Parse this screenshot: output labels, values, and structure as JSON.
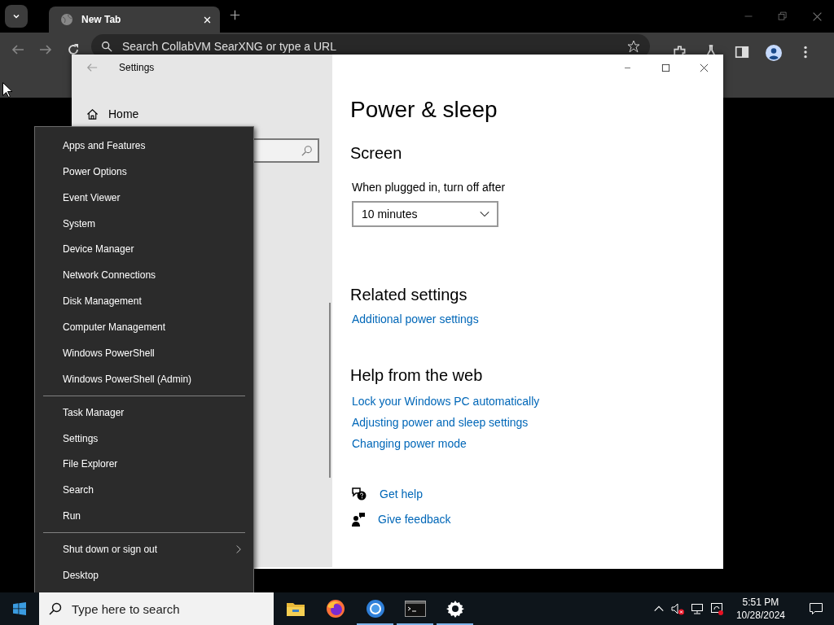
{
  "browser": {
    "tabs": [
      {
        "title": "New Tab",
        "selected": true
      }
    ],
    "address_bar": {
      "placeholder": "Search CollabVM SearXNG or type a URL"
    }
  },
  "settings_window": {
    "title": "Settings",
    "nav": [
      {
        "label": "Home"
      }
    ],
    "page_title": "Power & sleep",
    "screen": {
      "heading": "Screen",
      "label": "When plugged in, turn off after",
      "value": "10 minutes"
    },
    "related_settings": {
      "heading": "Related settings",
      "links": [
        "Additional power settings"
      ]
    },
    "help_from_web": {
      "heading": "Help from the web",
      "links": [
        "Lock your Windows PC automatically",
        "Adjusting power and sleep settings",
        "Changing power mode"
      ]
    },
    "support_links": [
      {
        "label": "Get help",
        "kind": "help"
      },
      {
        "label": "Give feedback",
        "kind": "feedback"
      }
    ]
  },
  "context_menu": {
    "groups": [
      [
        {
          "label": "Apps and Features",
          "submenu": false
        },
        {
          "label": "Power Options",
          "submenu": false
        },
        {
          "label": "Event Viewer",
          "submenu": false
        },
        {
          "label": "System",
          "submenu": false
        },
        {
          "label": "Device Manager",
          "submenu": false
        },
        {
          "label": "Network Connections",
          "submenu": false
        },
        {
          "label": "Disk Management",
          "submenu": false
        },
        {
          "label": "Computer Management",
          "submenu": false
        },
        {
          "label": "Windows PowerShell",
          "submenu": false
        },
        {
          "label": "Windows PowerShell (Admin)",
          "submenu": false
        }
      ],
      [
        {
          "label": "Task Manager",
          "submenu": false
        },
        {
          "label": "Settings",
          "submenu": false
        },
        {
          "label": "File Explorer",
          "submenu": false
        },
        {
          "label": "Search",
          "submenu": false
        },
        {
          "label": "Run",
          "submenu": false
        }
      ],
      [
        {
          "label": "Shut down or sign out",
          "submenu": true
        },
        {
          "label": "Desktop",
          "submenu": false
        }
      ]
    ]
  },
  "taskbar": {
    "search_placeholder": "Type here to search",
    "apps": [
      {
        "kind": "file-explorer",
        "running": false
      },
      {
        "kind": "firefox",
        "running": false
      },
      {
        "kind": "chromium",
        "running": true
      },
      {
        "kind": "terminal",
        "running": true
      },
      {
        "kind": "settings",
        "running": true
      }
    ],
    "clock": {
      "time": "5:51 PM",
      "date": "10/28/2024"
    }
  }
}
